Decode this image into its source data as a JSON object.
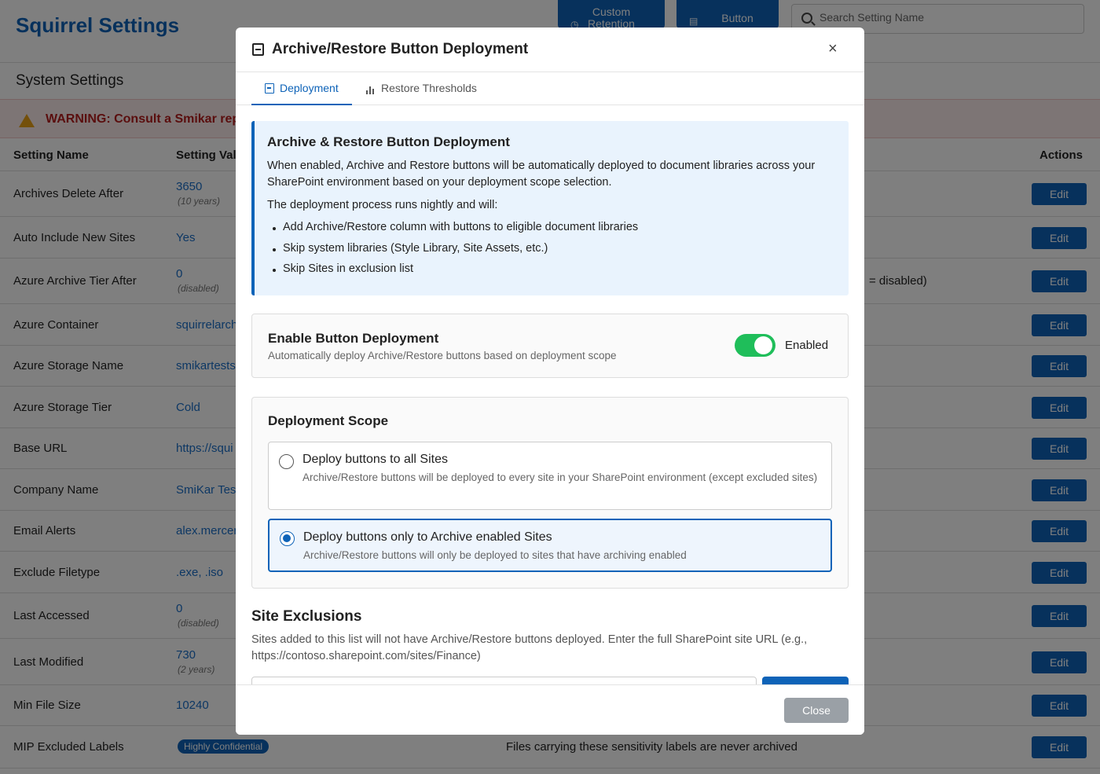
{
  "app": {
    "title": "Squirrel Settings",
    "toolbar": {
      "custom_retention_label": "Custom\nRetention",
      "button_label": "Button"
    },
    "search_placeholder": "Search Setting Name",
    "section_title": "System Settings",
    "warning_text": "WARNING: Consult a Smikar rep"
  },
  "table": {
    "headers": {
      "name": "Setting Name",
      "value": "Setting Valu",
      "actions": "Actions"
    },
    "edit_label": "Edit",
    "rows": [
      {
        "name": "Archives Delete After",
        "value": "3650",
        "sub": "(10 years)"
      },
      {
        "name": "Auto Include New Sites",
        "value": "Yes"
      },
      {
        "name": "Azure Archive Tier After",
        "value": "0",
        "sub": "(disabled)",
        "extra": "= disabled)"
      },
      {
        "name": "Azure Container",
        "value": "squirrelarch"
      },
      {
        "name": "Azure Storage Name",
        "value": "smikartests"
      },
      {
        "name": "Azure Storage Tier",
        "value": "Cold"
      },
      {
        "name": "Base URL",
        "value": "https://squi"
      },
      {
        "name": "Company Name",
        "value": "SmiKar Tes"
      },
      {
        "name": "Email Alerts",
        "value": "alex.mercer"
      },
      {
        "name": "Exclude Filetype",
        "value": ".exe, .iso"
      },
      {
        "name": "Last Accessed",
        "value": "0",
        "sub": "(disabled)"
      },
      {
        "name": "Last Modified",
        "value": "730",
        "sub": "(2 years)"
      },
      {
        "name": "Min File Size",
        "value": "10240"
      },
      {
        "name": "MIP Excluded Labels",
        "badge": "Highly Confidential",
        "desc": "Files carrying these sensitivity labels are never archived"
      }
    ]
  },
  "modal": {
    "title": "Archive/Restore Button Deployment",
    "close_icon": "×",
    "tabs": [
      {
        "label": "Deployment"
      },
      {
        "label": "Restore Thresholds"
      }
    ],
    "info": {
      "title": "Archive & Restore Button Deployment",
      "p1": "When enabled, Archive and Restore buttons will be automatically deployed to document libraries across your SharePoint environment based on your deployment scope selection.",
      "p2": "The deployment process runs nightly and will:",
      "bullets": [
        "Add Archive/Restore column with buttons to eligible document libraries",
        "Skip system libraries (Style Library, Site Assets, etc.)",
        "Skip Sites in exclusion list"
      ]
    },
    "enable": {
      "title": "Enable Button Deployment",
      "subtitle": "Automatically deploy Archive/Restore buttons based on deployment scope",
      "toggle_label": "Enabled"
    },
    "scope": {
      "title": "Deployment Scope",
      "options": [
        {
          "title": "Deploy buttons to all Sites",
          "desc": "Archive/Restore buttons will be deployed to every site in your SharePoint environment (except excluded sites)"
        },
        {
          "title": "Deploy buttons only to Archive enabled Sites",
          "desc": "Archive/Restore buttons will only be deployed to sites that have archiving enabled"
        }
      ]
    },
    "exclusions": {
      "title": "Site Exclusions",
      "desc": "Sites added to this list will not have Archive/Restore buttons deployed. Enter the full SharePoint site URL (e.g., https://contoso.sharepoint.com/sites/Finance)"
    },
    "close_button": "Close"
  },
  "colors": {
    "accent": "#0e63b8",
    "toggle_on": "#1fbe5a",
    "warning": "#b51c1c"
  }
}
